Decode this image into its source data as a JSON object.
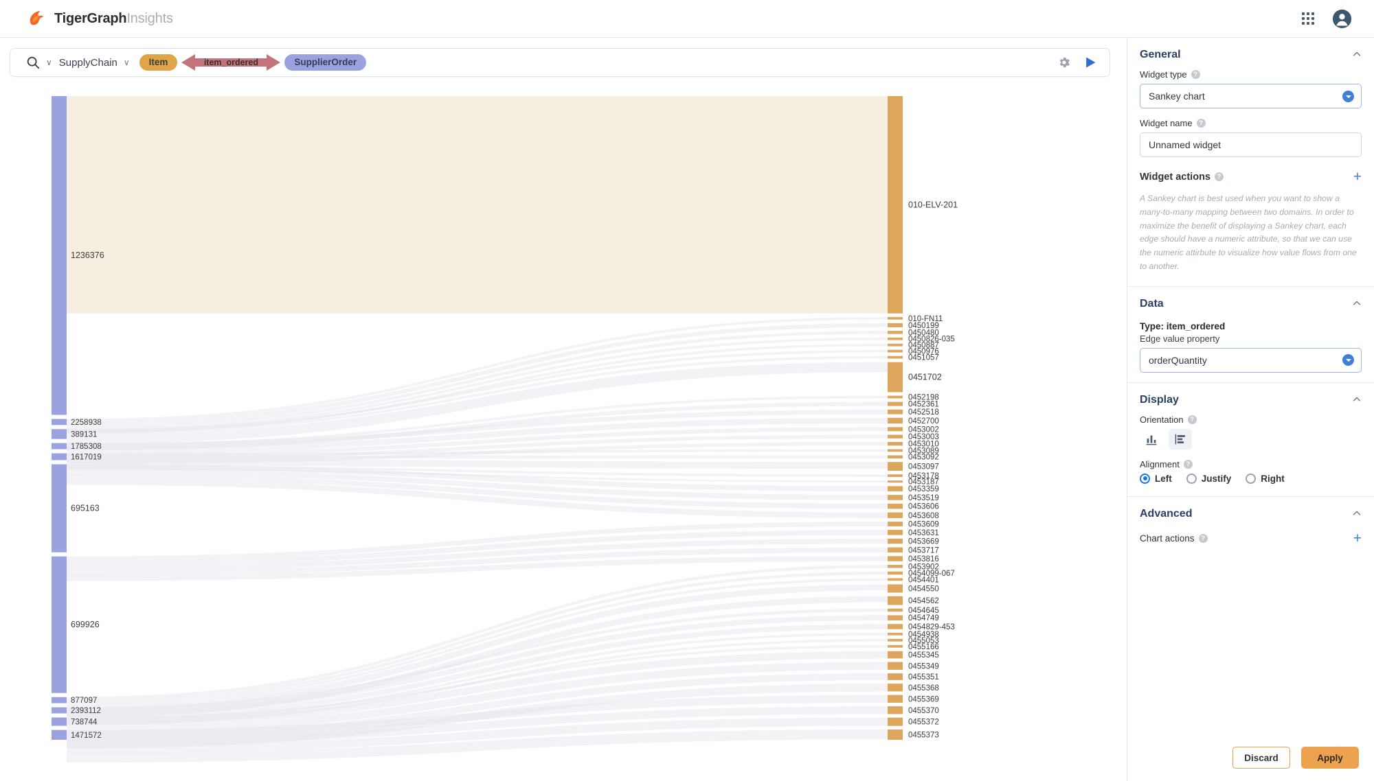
{
  "app": {
    "brand_primary": "TigerGraph",
    "brand_secondary": "Insights",
    "logo_icon": "tigergraph-flame-icon",
    "apps_icon": "app-grid-icon",
    "account_icon": "user-avatar-icon"
  },
  "querybar": {
    "search_icon": "search-icon",
    "search_caret": "∨",
    "graph_name": "SupplyChain",
    "graph_caret": "∨",
    "source_vertex": "Item",
    "edge_label": "item_ordered",
    "target_vertex": "SupplierOrder",
    "settings_icon": "gear-icon",
    "run_icon": "play-icon"
  },
  "panel": {
    "general": {
      "title": "General",
      "collapse_icon": "chevron-up-icon",
      "widget_type_label": "Widget type",
      "widget_type_value": "Sankey chart",
      "widget_name_label": "Widget name",
      "widget_name_value": "Unnamed widget",
      "widget_actions_label": "Widget actions",
      "add_icon": "plus-icon",
      "hint": "A Sankey chart is best used when you want to show a many-to-many mapping between two domains.\nIn order to maximize the benefit of displaying a Sankey chart, each edge should have a numeric attribute, so that we can use the numeric attirbute to visualize how value flows from one to another."
    },
    "data": {
      "title": "Data",
      "collapse_icon": "chevron-up-icon",
      "type_line": "Type: item_ordered",
      "edge_value_label": "Edge value property",
      "edge_value_value": "orderQuantity"
    },
    "display": {
      "title": "Display",
      "collapse_icon": "chevron-up-icon",
      "orientation_label": "Orientation",
      "orientation_vertical_icon": "vertical-bars-icon",
      "orientation_horizontal_icon": "horizontal-bars-icon",
      "orientation_selected": "horizontal",
      "alignment_label": "Alignment",
      "alignment_options": [
        "Left",
        "Justify",
        "Right"
      ],
      "alignment_selected": "Left"
    },
    "advanced": {
      "title": "Advanced",
      "collapse_icon": "chevron-up-icon",
      "chart_actions_label": "Chart actions",
      "add_icon": "plus-icon"
    },
    "footer": {
      "discard_label": "Discard",
      "apply_label": "Apply"
    }
  },
  "colors": {
    "source_node": "#9aa3e0",
    "target_node": "#dda65c",
    "accent_orange": "#eda24f",
    "accent_blue": "#3f7fd4",
    "edge_pill": "#c4737b"
  },
  "chart_data": {
    "type": "sankey",
    "title": "",
    "value_property": "orderQuantity",
    "source_nodes": [
      {
        "label": "1236376",
        "value": 420
      },
      {
        "label": "2258938",
        "value": 8
      },
      {
        "label": "389131",
        "value": 13
      },
      {
        "label": "1785308",
        "value": 8
      },
      {
        "label": "1617019",
        "value": 9
      },
      {
        "label": "695163",
        "value": 116
      },
      {
        "label": "699926",
        "value": 180
      },
      {
        "label": "877097",
        "value": 8
      },
      {
        "label": "2393112",
        "value": 8
      },
      {
        "label": "738744",
        "value": 11
      },
      {
        "label": "1471572",
        "value": 13
      }
    ],
    "target_nodes": [
      {
        "label": "010-ELV-201",
        "value": 420
      },
      {
        "label": "010-FN11",
        "value": 5
      },
      {
        "label": "0450199",
        "value": 8
      },
      {
        "label": "0450480",
        "value": 6
      },
      {
        "label": "0450826-035",
        "value": 5
      },
      {
        "label": "0450887",
        "value": 5
      },
      {
        "label": "0450976",
        "value": 5
      },
      {
        "label": "0451057",
        "value": 5
      },
      {
        "label": "0451702",
        "value": 58
      },
      {
        "label": "0452198",
        "value": 5
      },
      {
        "label": "0452361",
        "value": 8
      },
      {
        "label": "0452518",
        "value": 9
      },
      {
        "label": "0452700",
        "value": 11
      },
      {
        "label": "0453002",
        "value": 8
      },
      {
        "label": "0453003",
        "value": 7
      },
      {
        "label": "0453010",
        "value": 7
      },
      {
        "label": "0453089",
        "value": 5
      },
      {
        "label": "0453092",
        "value": 6
      },
      {
        "label": "0453097",
        "value": 17
      },
      {
        "label": "0453178",
        "value": 5
      },
      {
        "label": "0453187",
        "value": 4
      },
      {
        "label": "0453359",
        "value": 10
      },
      {
        "label": "0453519",
        "value": 10
      },
      {
        "label": "0453606",
        "value": 10
      },
      {
        "label": "0453608",
        "value": 11
      },
      {
        "label": "0453609",
        "value": 9
      },
      {
        "label": "0453631",
        "value": 10
      },
      {
        "label": "0453669",
        "value": 10
      },
      {
        "label": "0453717",
        "value": 10
      },
      {
        "label": "0453816",
        "value": 10
      },
      {
        "label": "0453902",
        "value": 6
      },
      {
        "label": "0454099-067",
        "value": 6
      },
      {
        "label": "0454401",
        "value": 5
      },
      {
        "label": "0454550",
        "value": 16
      },
      {
        "label": "0454562",
        "value": 17
      },
      {
        "label": "0454645",
        "value": 6
      },
      {
        "label": "0454749",
        "value": 10
      },
      {
        "label": "0454829-453",
        "value": 10
      },
      {
        "label": "0454938",
        "value": 5
      },
      {
        "label": "0455053",
        "value": 5
      },
      {
        "label": "0455166",
        "value": 5
      },
      {
        "label": "0455345",
        "value": 14
      },
      {
        "label": "0455349",
        "value": 15
      },
      {
        "label": "0455351",
        "value": 13
      },
      {
        "label": "0455368",
        "value": 15
      },
      {
        "label": "0455369",
        "value": 15
      },
      {
        "label": "0455370",
        "value": 15
      },
      {
        "label": "0455372",
        "value": 16
      },
      {
        "label": "0455373",
        "value": 20
      }
    ]
  }
}
